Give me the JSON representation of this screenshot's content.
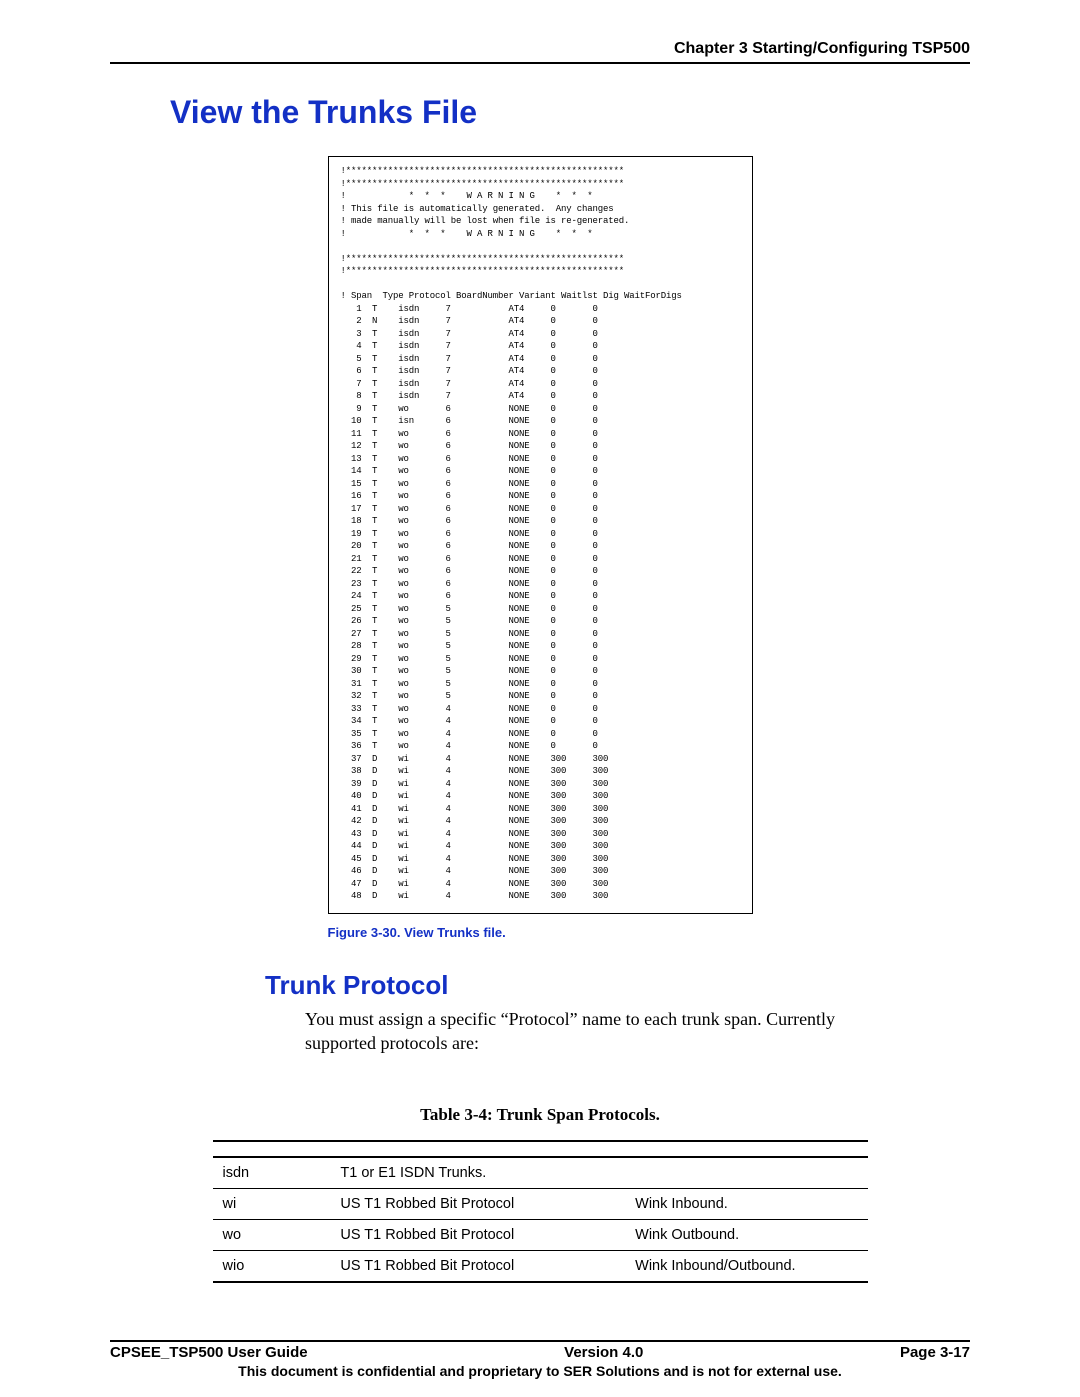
{
  "header": {
    "chapter": "Chapter 3 Starting/Configuring TSP500"
  },
  "h1": "View the Trunks File",
  "figure": {
    "warning_top": "            *  *  *    W A R N I N G    *  *  *",
    "warning_l2": " This file is automatically generated.  Any changes",
    "warning_l3": " made manually will be lost when file is re-generated.",
    "warning_bot": "            *  *  *    W A R N I N G    *  *  *",
    "colhead": " Span  Type Protocol BoardNumber Variant Waitlst Dig WaitForDigs",
    "starline": "!*****************************************************",
    "rows": [
      [
        " 1",
        "T",
        "isdn",
        "7",
        "AT4",
        "0",
        "0"
      ],
      [
        " 2",
        "N",
        "isdn",
        "7",
        "AT4",
        "0",
        "0"
      ],
      [
        " 3",
        "T",
        "isdn",
        "7",
        "AT4",
        "0",
        "0"
      ],
      [
        " 4",
        "T",
        "isdn",
        "7",
        "AT4",
        "0",
        "0"
      ],
      [
        " 5",
        "T",
        "isdn",
        "7",
        "AT4",
        "0",
        "0"
      ],
      [
        " 6",
        "T",
        "isdn",
        "7",
        "AT4",
        "0",
        "0"
      ],
      [
        " 7",
        "T",
        "isdn",
        "7",
        "AT4",
        "0",
        "0"
      ],
      [
        " 8",
        "T",
        "isdn",
        "7",
        "AT4",
        "0",
        "0"
      ],
      [
        " 9",
        "T",
        "wo",
        "6",
        "NONE",
        "0",
        "0"
      ],
      [
        "10",
        "T",
        "isn",
        "6",
        "NONE",
        "0",
        "0"
      ],
      [
        "11",
        "T",
        "wo",
        "6",
        "NONE",
        "0",
        "0"
      ],
      [
        "12",
        "T",
        "wo",
        "6",
        "NONE",
        "0",
        "0"
      ],
      [
        "13",
        "T",
        "wo",
        "6",
        "NONE",
        "0",
        "0"
      ],
      [
        "14",
        "T",
        "wo",
        "6",
        "NONE",
        "0",
        "0"
      ],
      [
        "15",
        "T",
        "wo",
        "6",
        "NONE",
        "0",
        "0"
      ],
      [
        "16",
        "T",
        "wo",
        "6",
        "NONE",
        "0",
        "0"
      ],
      [
        "17",
        "T",
        "wo",
        "6",
        "NONE",
        "0",
        "0"
      ],
      [
        "18",
        "T",
        "wo",
        "6",
        "NONE",
        "0",
        "0"
      ],
      [
        "19",
        "T",
        "wo",
        "6",
        "NONE",
        "0",
        "0"
      ],
      [
        "20",
        "T",
        "wo",
        "6",
        "NONE",
        "0",
        "0"
      ],
      [
        "21",
        "T",
        "wo",
        "6",
        "NONE",
        "0",
        "0"
      ],
      [
        "22",
        "T",
        "wo",
        "6",
        "NONE",
        "0",
        "0"
      ],
      [
        "23",
        "T",
        "wo",
        "6",
        "NONE",
        "0",
        "0"
      ],
      [
        "24",
        "T",
        "wo",
        "6",
        "NONE",
        "0",
        "0"
      ],
      [
        "25",
        "T",
        "wo",
        "5",
        "NONE",
        "0",
        "0"
      ],
      [
        "26",
        "T",
        "wo",
        "5",
        "NONE",
        "0",
        "0"
      ],
      [
        "27",
        "T",
        "wo",
        "5",
        "NONE",
        "0",
        "0"
      ],
      [
        "28",
        "T",
        "wo",
        "5",
        "NONE",
        "0",
        "0"
      ],
      [
        "29",
        "T",
        "wo",
        "5",
        "NONE",
        "0",
        "0"
      ],
      [
        "30",
        "T",
        "wo",
        "5",
        "NONE",
        "0",
        "0"
      ],
      [
        "31",
        "T",
        "wo",
        "5",
        "NONE",
        "0",
        "0"
      ],
      [
        "32",
        "T",
        "wo",
        "5",
        "NONE",
        "0",
        "0"
      ],
      [
        "33",
        "T",
        "wo",
        "4",
        "NONE",
        "0",
        "0"
      ],
      [
        "34",
        "T",
        "wo",
        "4",
        "NONE",
        "0",
        "0"
      ],
      [
        "35",
        "T",
        "wo",
        "4",
        "NONE",
        "0",
        "0"
      ],
      [
        "36",
        "T",
        "wo",
        "4",
        "NONE",
        "0",
        "0"
      ],
      [
        "37",
        "D",
        "wi",
        "4",
        "NONE",
        "300",
        "300"
      ],
      [
        "38",
        "D",
        "wi",
        "4",
        "NONE",
        "300",
        "300"
      ],
      [
        "39",
        "D",
        "wi",
        "4",
        "NONE",
        "300",
        "300"
      ],
      [
        "40",
        "D",
        "wi",
        "4",
        "NONE",
        "300",
        "300"
      ],
      [
        "41",
        "D",
        "wi",
        "4",
        "NONE",
        "300",
        "300"
      ],
      [
        "42",
        "D",
        "wi",
        "4",
        "NONE",
        "300",
        "300"
      ],
      [
        "43",
        "D",
        "wi",
        "4",
        "NONE",
        "300",
        "300"
      ],
      [
        "44",
        "D",
        "wi",
        "4",
        "NONE",
        "300",
        "300"
      ],
      [
        "45",
        "D",
        "wi",
        "4",
        "NONE",
        "300",
        "300"
      ],
      [
        "46",
        "D",
        "wi",
        "4",
        "NONE",
        "300",
        "300"
      ],
      [
        "47",
        "D",
        "wi",
        "4",
        "NONE",
        "300",
        "300"
      ],
      [
        "48",
        "D",
        "wi",
        "4",
        "NONE",
        "300",
        "300"
      ]
    ]
  },
  "caption": "Figure 3-30. View Trunks file.",
  "h2": "Trunk Protocol",
  "body": "You must assign a specific “Protocol” name to each trunk span. Currently supported protocols are:",
  "table_title": "Table 3-4: Trunk Span Protocols.",
  "table_rows": [
    {
      "c1": "isdn",
      "c2": "T1 or E1 ISDN Trunks.",
      "c3": ""
    },
    {
      "c1": "wi",
      "c2": "US T1 Robbed Bit Protocol",
      "c3": "Wink Inbound."
    },
    {
      "c1": "wo",
      "c2": "US T1 Robbed Bit Protocol",
      "c3": "Wink Outbound."
    },
    {
      "c1": "wio",
      "c2": "US T1 Robbed Bit Protocol",
      "c3": "Wink Inbound/Outbound."
    }
  ],
  "footer": {
    "left": "CPSEE_TSP500 User Guide",
    "center": "Version 4.0",
    "right": "Page 3-17",
    "sub": "This document is confidential and proprietary to SER Solutions and is not for external use."
  }
}
